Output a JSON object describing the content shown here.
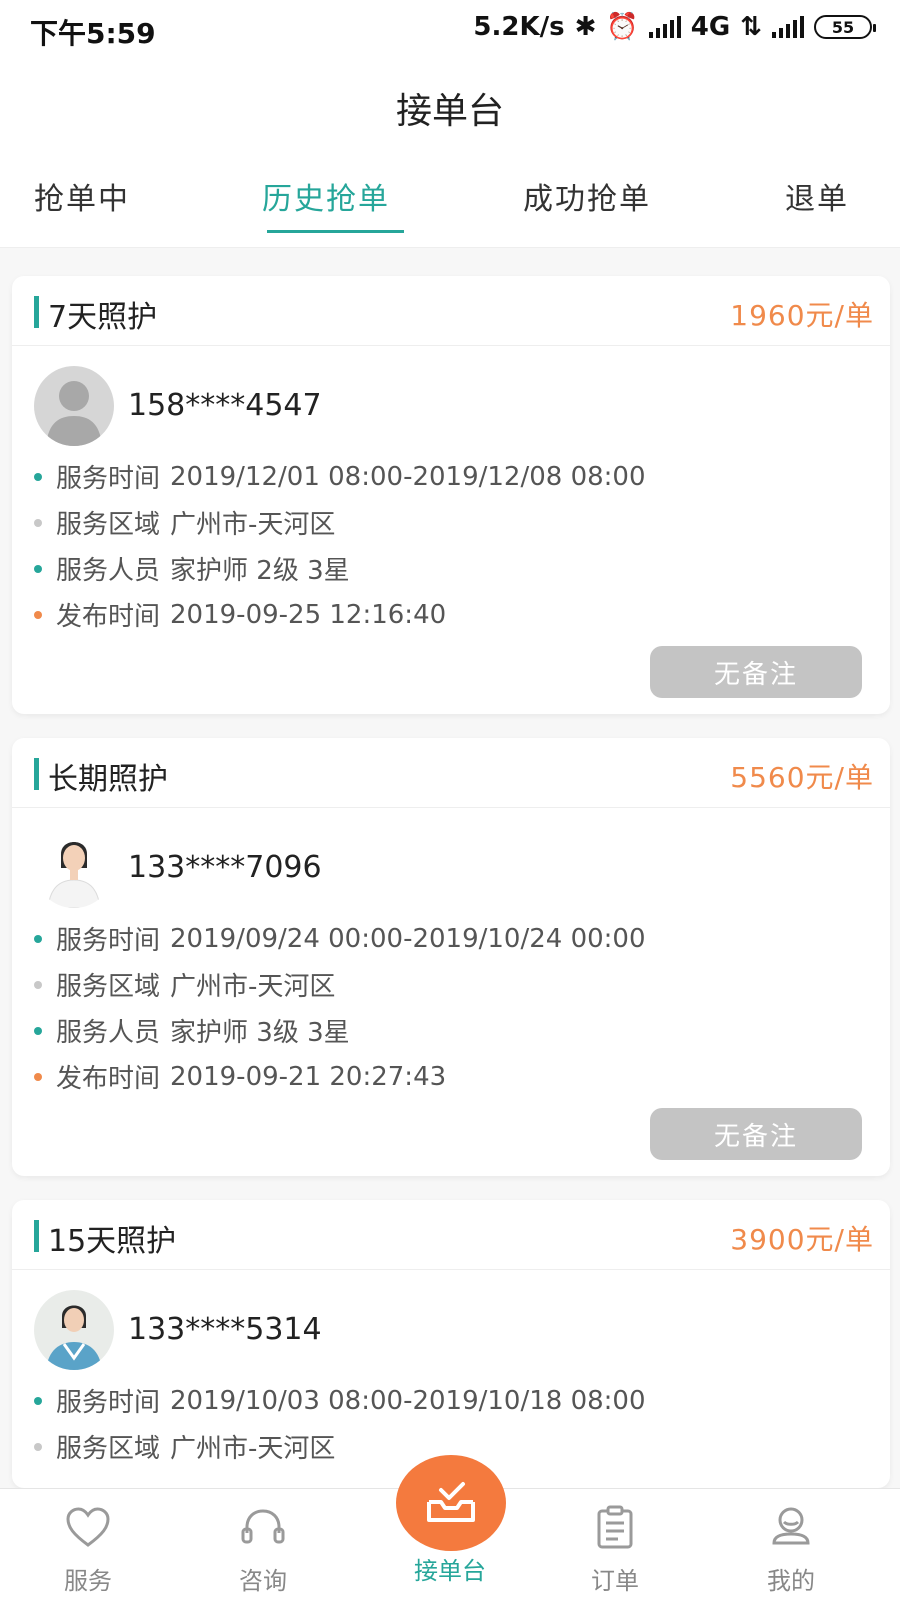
{
  "status_bar": {
    "time": "下午5:59",
    "net_speed": "5.2K/s",
    "network": "4G",
    "battery": "55"
  },
  "header": {
    "title": "接单台"
  },
  "tabs": [
    {
      "label": "抢单中"
    },
    {
      "label": "历史抢单",
      "active": true
    },
    {
      "label": "成功抢单"
    },
    {
      "label": "退单"
    }
  ],
  "orders": [
    {
      "title": "7天照护",
      "price": "1960元/单",
      "phone": "158****4547",
      "service_time_label": "服务时间",
      "service_time": "2019/12/01 08:00-2019/12/08 08:00",
      "area_label": "服务区域",
      "area": "广州市-天河区",
      "staff_label": "服务人员",
      "staff": "家护师 2级 3星",
      "publish_label": "发布时间",
      "publish_time": "2019-09-25 12:16:40",
      "note_button": "无备注"
    },
    {
      "title": "长期照护",
      "price": "5560元/单",
      "phone": "133****7096",
      "service_time_label": "服务时间",
      "service_time": "2019/09/24 00:00-2019/10/24 00:00",
      "area_label": "服务区域",
      "area": "广州市-天河区",
      "staff_label": "服务人员",
      "staff": "家护师 3级 3星",
      "publish_label": "发布时间",
      "publish_time": "2019-09-21 20:27:43",
      "note_button": "无备注"
    },
    {
      "title": "15天照护",
      "price": "3900元/单",
      "phone": "133****5314",
      "service_time_label": "服务时间",
      "service_time": "2019/10/03 08:00-2019/10/18 08:00",
      "area_label": "服务区域",
      "area": "广州市-天河区"
    }
  ],
  "bottom_nav": [
    {
      "label": "服务",
      "icon": "heart-icon"
    },
    {
      "label": "咨询",
      "icon": "headset-icon"
    },
    {
      "label": "接单台",
      "icon": "inbox-check-icon",
      "active": true
    },
    {
      "label": "订单",
      "icon": "clipboard-icon"
    },
    {
      "label": "我的",
      "icon": "user-icon"
    }
  ],
  "colors": {
    "accent": "#26a69a",
    "price": "#f08a4b",
    "center_button": "#f47a3e",
    "dot_teal": "#26a69a",
    "dot_gray": "#c8c8c8",
    "dot_orange": "#f08a4b"
  }
}
